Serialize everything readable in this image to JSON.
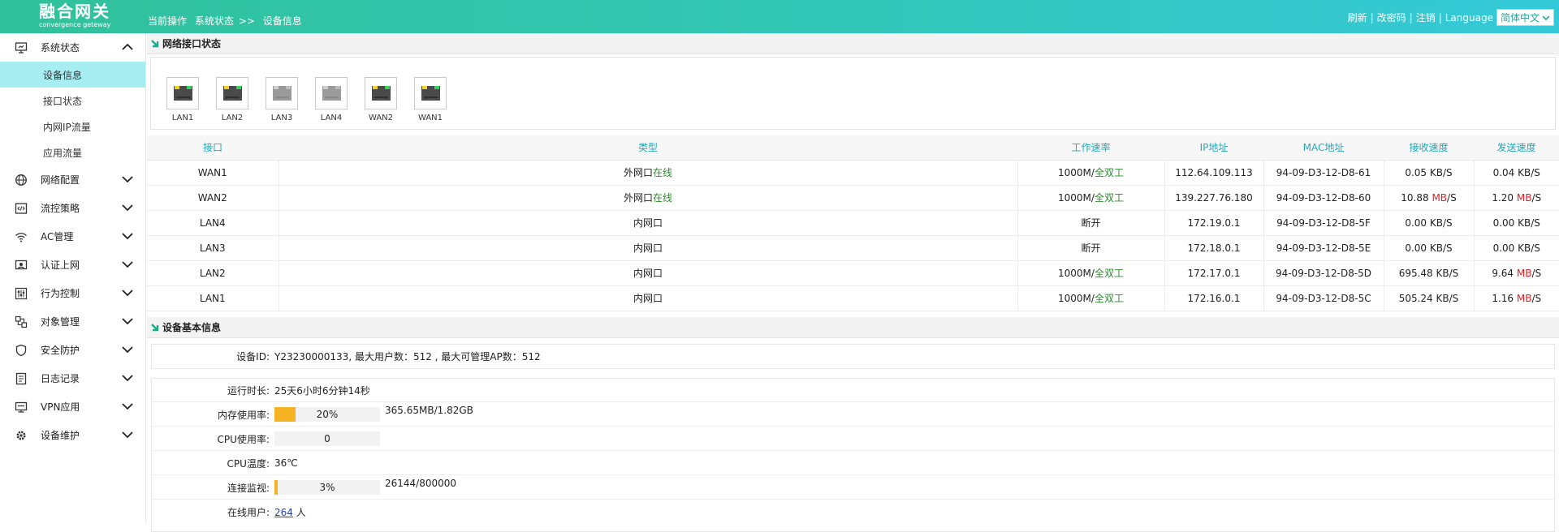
{
  "header": {
    "logo_title": "融合网关",
    "logo_sub": "convergence geteway",
    "crumb_label": "当前操作",
    "crumb_path1": "系统状态",
    "crumb_sep": ">>",
    "crumb_path2": "设备信息",
    "actions": {
      "refresh": "刷新",
      "sep1": "|",
      "change_pwd": "改密码",
      "sep2": "|",
      "logout": "注销",
      "sep3": "|",
      "language_label": "Language"
    },
    "language_value": "简体中文"
  },
  "sidebar": {
    "groups": [
      {
        "label": "系统状态",
        "icon": "monitor-icon",
        "expanded": true
      },
      {
        "label": "网络配置",
        "icon": "globe-icon"
      },
      {
        "label": "流控策略",
        "icon": "code-window-icon"
      },
      {
        "label": "AC管理",
        "icon": "wifi-icon"
      },
      {
        "label": "认证上网",
        "icon": "auth-icon"
      },
      {
        "label": "行为控制",
        "icon": "sliders-icon"
      },
      {
        "label": "对象管理",
        "icon": "objects-icon"
      },
      {
        "label": "安全防护",
        "icon": "shield-icon"
      },
      {
        "label": "日志记录",
        "icon": "log-icon"
      },
      {
        "label": "VPN应用",
        "icon": "vpn-icon"
      },
      {
        "label": "设备维护",
        "icon": "gear-icon"
      }
    ],
    "sub_items": [
      "设备信息",
      "接口状态",
      "内网IP流量",
      "应用流量"
    ]
  },
  "ports_section": {
    "title": "网络接口状态",
    "ports": [
      {
        "label": "LAN1",
        "status": "up"
      },
      {
        "label": "LAN2",
        "status": "up"
      },
      {
        "label": "LAN3",
        "status": "down"
      },
      {
        "label": "LAN4",
        "status": "down"
      },
      {
        "label": "WAN2",
        "status": "up"
      },
      {
        "label": "WAN1",
        "status": "up"
      }
    ]
  },
  "port_table": {
    "headers": [
      "接口",
      "类型",
      "工作速率",
      "IP地址",
      "MAC地址",
      "接收速度",
      "发送速度"
    ],
    "rows": [
      {
        "iface": "WAN1",
        "type_a": "外网口",
        "type_b": "在线",
        "rate_a": "1000M/",
        "rate_b": "全双工",
        "ip": "112.64.109.113",
        "mac": "94-09-D3-12-D8-61",
        "rx_num": "0.05 ",
        "rx_unit": "KB",
        "rx_tail": "/S",
        "tx_num": "0.04 ",
        "tx_unit": "KB",
        "tx_tail": "/S"
      },
      {
        "iface": "WAN2",
        "type_a": "外网口",
        "type_b": "在线",
        "rate_a": "1000M/",
        "rate_b": "全双工",
        "ip": "139.227.76.180",
        "mac": "94-09-D3-12-D8-60",
        "rx_num": "10.88 ",
        "rx_unit": "MB",
        "rx_tail": "/S",
        "tx_num": "1.20 ",
        "tx_unit": "MB",
        "tx_tail": "/S"
      },
      {
        "iface": "LAN4",
        "type_a": "内网口",
        "type_b": "",
        "rate_a": "断开",
        "rate_b": "",
        "ip": "172.19.0.1",
        "mac": "94-09-D3-12-D8-5F",
        "rx_num": "0.00 ",
        "rx_unit": "KB",
        "rx_tail": "/S",
        "tx_num": "0.00 ",
        "tx_unit": "KB",
        "tx_tail": "/S"
      },
      {
        "iface": "LAN3",
        "type_a": "内网口",
        "type_b": "",
        "rate_a": "断开",
        "rate_b": "",
        "ip": "172.18.0.1",
        "mac": "94-09-D3-12-D8-5E",
        "rx_num": "0.00 ",
        "rx_unit": "KB",
        "rx_tail": "/S",
        "tx_num": "0.00 ",
        "tx_unit": "KB",
        "tx_tail": "/S"
      },
      {
        "iface": "LAN2",
        "type_a": "内网口",
        "type_b": "",
        "rate_a": "1000M/",
        "rate_b": "全双工",
        "ip": "172.17.0.1",
        "mac": "94-09-D3-12-D8-5D",
        "rx_num": "695.48 ",
        "rx_unit": "KB",
        "rx_tail": "/S",
        "tx_num": "9.64 ",
        "tx_unit": "MB",
        "tx_tail": "/S"
      },
      {
        "iface": "LAN1",
        "type_a": "内网口",
        "type_b": "",
        "rate_a": "1000M/",
        "rate_b": "全双工",
        "ip": "172.16.0.1",
        "mac": "94-09-D3-12-D8-5C",
        "rx_num": "505.24 ",
        "rx_unit": "KB",
        "rx_tail": "/S",
        "tx_num": "1.16 ",
        "tx_unit": "MB",
        "tx_tail": "/S"
      }
    ]
  },
  "device_info": {
    "title": "设备基本信息",
    "device_id_label": "设备ID:",
    "device_id_value": "Y23230000133, 最大用户数：512 , 最大可管理AP数：512",
    "uptime_label": "运行时长:",
    "uptime_value": "25天6小时6分钟14秒",
    "mem_label": "内存使用率:",
    "mem_percent": 20,
    "mem_text": "20%",
    "mem_detail": "365.65MB/1.82GB",
    "cpu_label": "CPU使用率:",
    "cpu_percent": 0,
    "cpu_text": "0",
    "temp_label": "CPU温度:",
    "temp_value": "36℃",
    "conn_label": "连接监视:",
    "conn_percent": 3,
    "conn_text": "3%",
    "conn_detail": "26144/800000",
    "users_label": "在线用户:",
    "users_value": "264",
    "users_unit": "人"
  },
  "colors": {
    "accent": "#2fc4b0",
    "active_menu": "#a7eef2",
    "bar_fill": "#f5b324",
    "online_green": "#2b8a2b",
    "unit_red": "#e02020"
  }
}
